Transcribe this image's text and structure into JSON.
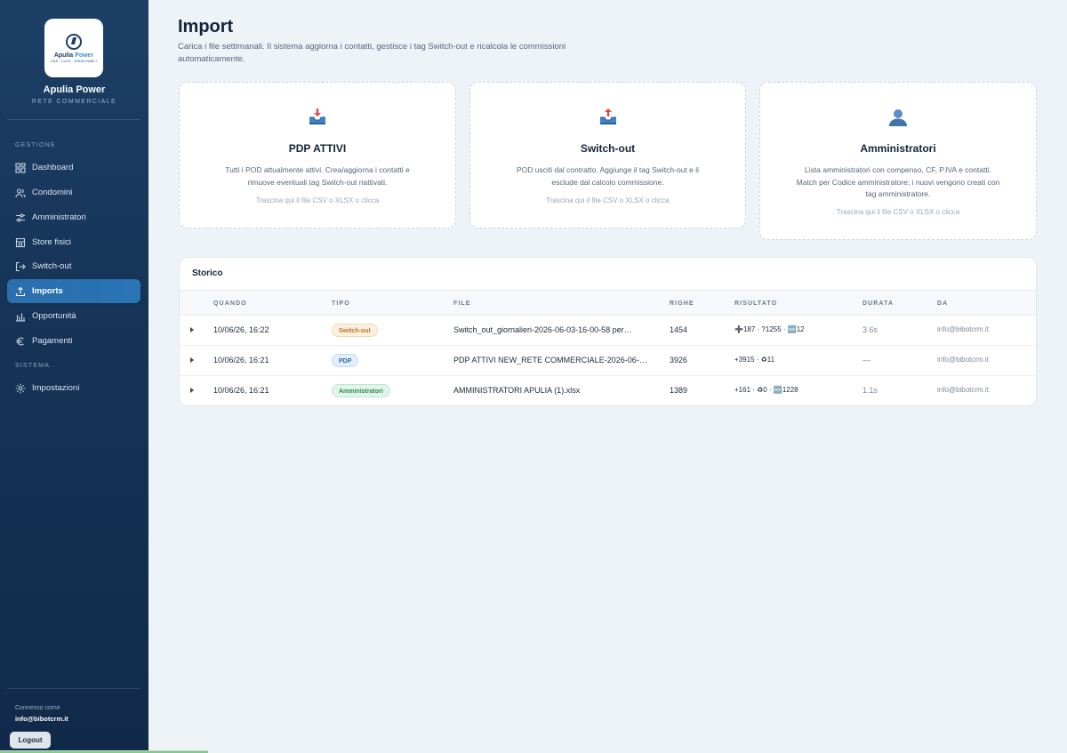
{
  "brand": {
    "logo_text_main": "Apulia",
    "logo_text_accent": "Power",
    "logo_tagline": "GAS · LUCE · RINNOVABILI",
    "title": "Apulia Power",
    "subtitle": "RETE COMMERCIALE"
  },
  "sidebar": {
    "section_gestione": "GESTIONE",
    "section_sistema": "SISTEMA",
    "items": [
      {
        "label": "Dashboard",
        "icon": "grid-icon"
      },
      {
        "label": "Condomini",
        "icon": "users-icon"
      },
      {
        "label": "Amministratori",
        "icon": "sliders-icon"
      },
      {
        "label": "Store fisici",
        "icon": "store-icon"
      },
      {
        "label": "Switch-out",
        "icon": "logout-arrow-icon"
      },
      {
        "label": "Imports",
        "icon": "upload-icon",
        "active": true
      },
      {
        "label": "Opportunità",
        "icon": "bar-chart-icon"
      },
      {
        "label": "Pagamenti",
        "icon": "currency-icon"
      }
    ],
    "settings_label": "Impostazioni",
    "connected_label": "Connesso come",
    "connected_email": "info@bibotcrm.it",
    "logout_label": "Logout"
  },
  "header": {
    "title": "Import",
    "description": "Carica i file settimanali. Il sistema aggiorna i contatti, gestisce i tag Switch-out e ricalcola le commissioni automaticamente."
  },
  "cards": [
    {
      "title": "PDP ATTIVI",
      "description": "Tutti i POD attualmente attivi. Crea/aggiorna i contatti e rimuove eventuali tag Switch-out riattivati.",
      "hint": "Trascina qui il file CSV o XLSX o clicca",
      "icon": "inbox-tray-icon"
    },
    {
      "title": "Switch-out",
      "description": "POD usciti dal contratto. Aggiunge il tag Switch-out e li esclude dal calcolo commissione.",
      "hint": "Trascina qui il file CSV o XLSX o clicca",
      "icon": "outbox-tray-icon"
    },
    {
      "title": "Amministratori",
      "description": "Lista amministratori con compenso, CF, P.IVA e contatti. Match per Codice amministratore; i nuovi vengono creati con tag amministratore.",
      "hint": "Trascina qui il file CSV o XLSX o clicca",
      "icon": "person-silhouette-icon"
    }
  ],
  "history": {
    "title": "Storico",
    "columns": [
      "QUANDO",
      "TIPO",
      "FILE",
      "RIGHE",
      "RISULTATO",
      "DURATA",
      "DA"
    ],
    "rows": [
      {
        "when": "10/06/26, 16:22",
        "type": "Switch-out",
        "type_style": "switch",
        "file": "Switch_out_giornalieri-2026-06-03-16-00-58 per…",
        "rows": "1454",
        "result": "➕187 · ?1255 · 🆕12",
        "duration": "3.6s",
        "by": "info@bibotcrm.it"
      },
      {
        "when": "10/06/26, 16:21",
        "type": "PDP",
        "type_style": "pdp",
        "file": "PDP ATTIVI NEW_RETE COMMERCIALE-2026-06-…",
        "rows": "3926",
        "result": "+3915 · ♻11",
        "duration": "—",
        "by": "info@bibotcrm.it"
      },
      {
        "when": "10/06/26, 16:21",
        "type": "Amministratori",
        "type_style": "admin",
        "file": "AMMINISTRATORI APULIA (1).xlsx",
        "rows": "1389",
        "result": "+161 · ♻0 · 🆕1228",
        "duration": "1.1s",
        "by": "info@bibotcrm.it"
      }
    ]
  },
  "colors": {
    "sidebar_bg": "#163356",
    "active_nav": "#2874b5",
    "switch_badge": "#c5741e",
    "pdp_badge": "#2d6aa8",
    "admin_badge": "#2b8a50"
  }
}
